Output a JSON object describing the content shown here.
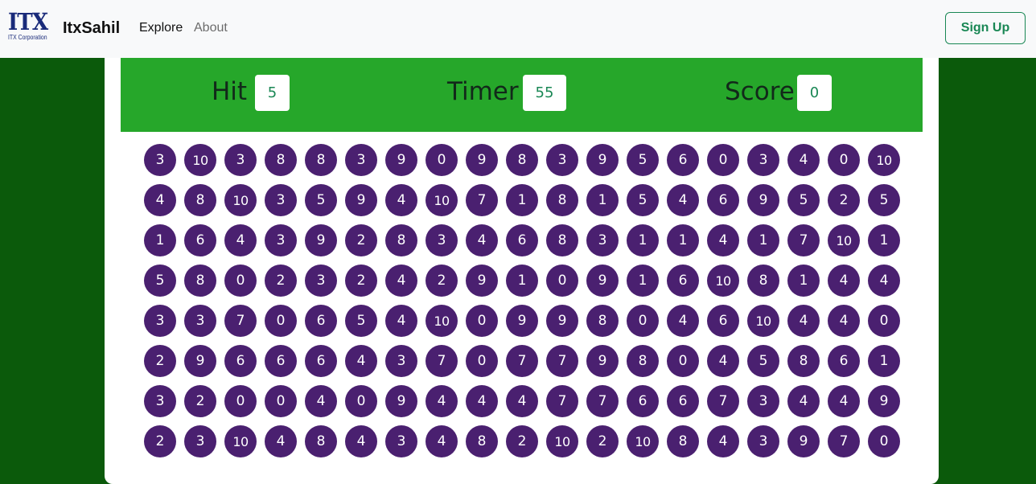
{
  "navbar": {
    "logo_mark": "ITX",
    "logo_sub": "ITX Corporation",
    "brand": "ItxSahil",
    "links": [
      "Explore",
      "About"
    ],
    "signup_label": "Sign Up"
  },
  "panel": {
    "hit_label": "Hit",
    "hit_value": "5",
    "timer_label": "Timer",
    "timer_value": "55",
    "score_label": "Score",
    "score_value": "0"
  },
  "grid": [
    [
      "3",
      "10",
      "3",
      "8",
      "8",
      "3",
      "9",
      "0",
      "9",
      "8",
      "3",
      "9",
      "5",
      "6",
      "0",
      "3",
      "4",
      "0",
      "10"
    ],
    [
      "4",
      "8",
      "10",
      "3",
      "5",
      "9",
      "4",
      "10",
      "7",
      "1",
      "8",
      "1",
      "5",
      "4",
      "6",
      "9",
      "5",
      "2",
      "5"
    ],
    [
      "1",
      "6",
      "4",
      "3",
      "9",
      "2",
      "8",
      "3",
      "4",
      "6",
      "8",
      "3",
      "1",
      "1",
      "4",
      "1",
      "7",
      "10",
      "1"
    ],
    [
      "5",
      "8",
      "0",
      "2",
      "3",
      "2",
      "4",
      "2",
      "9",
      "1",
      "0",
      "9",
      "1",
      "6",
      "10",
      "8",
      "1",
      "4",
      "4"
    ],
    [
      "3",
      "3",
      "7",
      "0",
      "6",
      "5",
      "4",
      "10",
      "0",
      "9",
      "9",
      "8",
      "0",
      "4",
      "6",
      "10",
      "4",
      "4",
      "0"
    ],
    [
      "2",
      "9",
      "6",
      "6",
      "6",
      "4",
      "3",
      "7",
      "0",
      "7",
      "7",
      "9",
      "8",
      "0",
      "4",
      "5",
      "8",
      "6",
      "1"
    ],
    [
      "3",
      "2",
      "0",
      "0",
      "4",
      "0",
      "9",
      "4",
      "4",
      "4",
      "7",
      "7",
      "6",
      "6",
      "7",
      "3",
      "4",
      "4",
      "9"
    ],
    [
      "2",
      "3",
      "10",
      "4",
      "8",
      "4",
      "3",
      "4",
      "8",
      "2",
      "10",
      "2",
      "10",
      "8",
      "4",
      "3",
      "9",
      "7",
      "0"
    ]
  ],
  "colors": {
    "background": "#0b5a0b",
    "panel": "#26a72a",
    "bubble": "#4a2070",
    "accent": "#198754"
  }
}
